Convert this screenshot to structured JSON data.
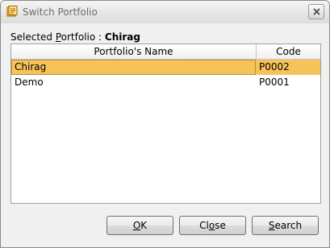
{
  "window": {
    "title": "Switch Portfolio",
    "icon": "portfolio-app-icon"
  },
  "selected": {
    "label_prefix": "Selected ",
    "label_access": "P",
    "label_rest": "ortfolio : ",
    "value": "Chirag"
  },
  "table": {
    "headers": {
      "name": "Portfolio's Name",
      "code": "Code"
    },
    "rows": [
      {
        "name": "Chirag",
        "code": "P0002",
        "selected": true
      },
      {
        "name": "Demo",
        "code": "P0001",
        "selected": false
      }
    ]
  },
  "buttons": {
    "ok": {
      "access": "O",
      "rest": "K"
    },
    "close": {
      "pre": "Cl",
      "access": "o",
      "rest": "se"
    },
    "search": {
      "access": "S",
      "rest": "earch"
    }
  },
  "colors": {
    "selected_row": "#f6c35a",
    "title_text": "#6d6d6d"
  }
}
